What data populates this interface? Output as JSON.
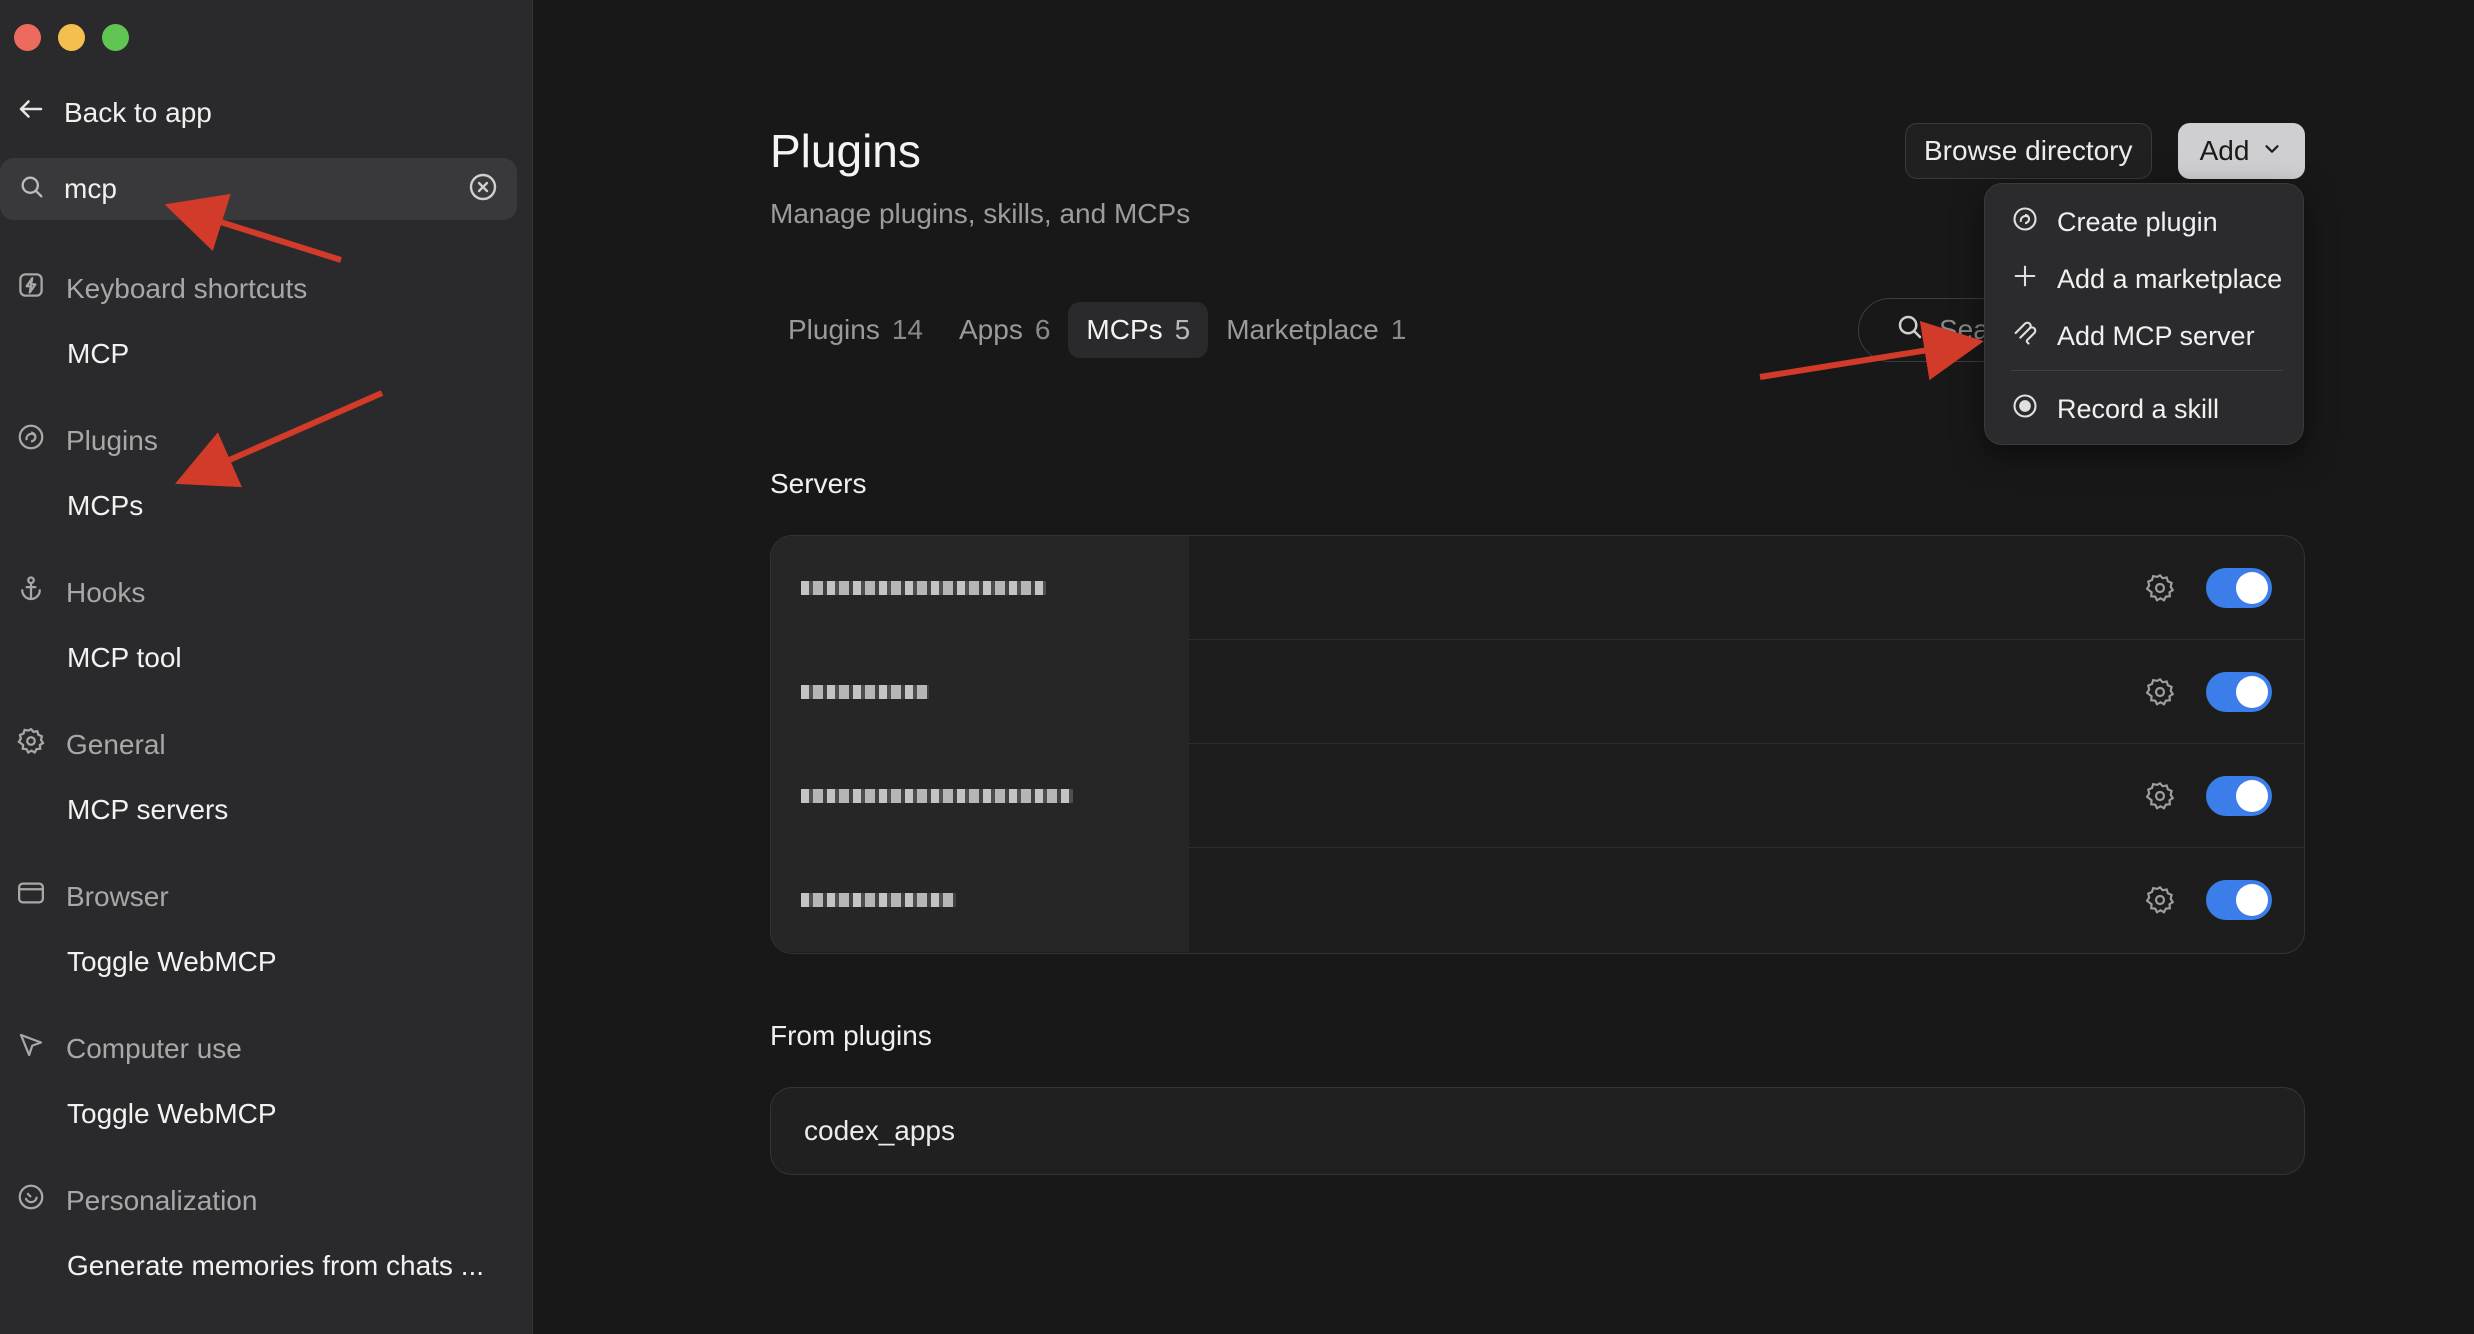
{
  "window": {
    "controls": [
      "close",
      "minimize",
      "zoom"
    ]
  },
  "sidebar": {
    "back_label": "Back to app",
    "search": {
      "value": "mcp"
    },
    "sections": [
      {
        "label": "Keyboard shortcuts",
        "icon": "bolt-icon",
        "items": [
          "MCP"
        ]
      },
      {
        "label": "Plugins",
        "icon": "plugin-icon",
        "items": [
          "MCPs"
        ]
      },
      {
        "label": "Hooks",
        "icon": "anchor-icon",
        "items": [
          "MCP tool"
        ]
      },
      {
        "label": "General",
        "icon": "gear-icon",
        "items": [
          "MCP servers"
        ]
      },
      {
        "label": "Browser",
        "icon": "browser-icon",
        "items": [
          "Toggle WebMCP"
        ]
      },
      {
        "label": "Computer use",
        "icon": "cursor-icon",
        "items": [
          "Toggle WebMCP"
        ]
      },
      {
        "label": "Personalization",
        "icon": "personalization-icon",
        "items": [
          "Generate memories from chats ..."
        ]
      }
    ]
  },
  "main": {
    "title": "Plugins",
    "subtitle": "Manage plugins, skills, and MCPs",
    "browse_label": "Browse directory",
    "add_label": "Add",
    "tabs": [
      {
        "label": "Plugins",
        "count": "14"
      },
      {
        "label": "Apps",
        "count": "6"
      },
      {
        "label": "MCPs",
        "count": "5"
      },
      {
        "label": "Marketplace",
        "count": "1"
      }
    ],
    "active_tab": "MCPs",
    "search_placeholder": "Sear",
    "servers_title": "Servers",
    "servers": [
      {
        "enabled": true
      },
      {
        "enabled": true
      },
      {
        "enabled": true
      },
      {
        "enabled": true
      }
    ],
    "from_plugins_title": "From plugins",
    "from_plugins": [
      "codex_apps"
    ]
  },
  "add_menu": {
    "items": [
      "Create plugin",
      "Add a marketplace",
      "Add MCP server",
      "Record a skill"
    ]
  },
  "colors": {
    "accent": "#3b7de9",
    "annotation": "#d23a2a",
    "background": "#181818",
    "sidebar": "#2a2a2c"
  }
}
